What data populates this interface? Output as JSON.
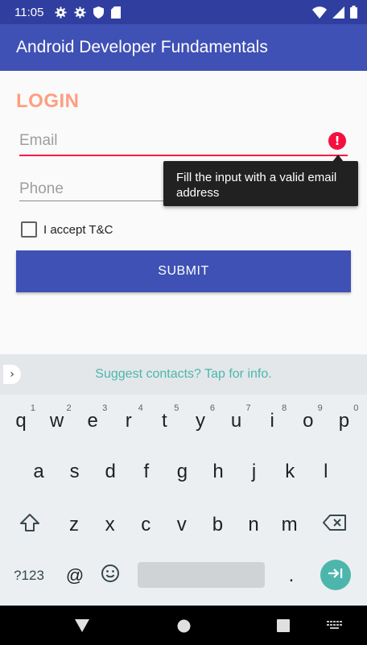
{
  "status_bar": {
    "time": "11:05",
    "left_icons": [
      "settings-icon",
      "settings-icon",
      "shield-icon",
      "sd-card-icon"
    ],
    "right_icons": [
      "wifi-icon",
      "signal-icon",
      "battery-icon"
    ]
  },
  "app_bar": {
    "title": "Android Developer Fundamentals"
  },
  "form": {
    "title": "LOGIN",
    "email_placeholder": "Email",
    "phone_placeholder": "Phone",
    "error_message": "Fill the input with a valid email address",
    "checkbox_label": "I accept T&C",
    "checkbox_checked": false,
    "submit_label": "SUBMIT"
  },
  "keyboard": {
    "suggestion": "Suggest contacts? Tap for info.",
    "row1": [
      {
        "k": "q",
        "h": "1"
      },
      {
        "k": "w",
        "h": "2"
      },
      {
        "k": "e",
        "h": "3"
      },
      {
        "k": "r",
        "h": "4"
      },
      {
        "k": "t",
        "h": "5"
      },
      {
        "k": "y",
        "h": "6"
      },
      {
        "k": "u",
        "h": "7"
      },
      {
        "k": "i",
        "h": "8"
      },
      {
        "k": "o",
        "h": "9"
      },
      {
        "k": "p",
        "h": "0"
      }
    ],
    "row2": [
      "a",
      "s",
      "d",
      "f",
      "g",
      "h",
      "j",
      "k",
      "l"
    ],
    "row3": [
      "z",
      "x",
      "c",
      "v",
      "b",
      "n",
      "m"
    ],
    "symbols_label": "?123",
    "at_label": "@",
    "period_label": ".",
    "emoji_icon": "emoji-icon",
    "shift_icon": "shift-icon",
    "backspace_icon": "backspace-icon",
    "enter_icon": "next-arrow-icon"
  },
  "nav_bar": {
    "icons": [
      "back-icon",
      "home-icon",
      "recents-icon",
      "keyboard-switch-icon"
    ]
  },
  "colors": {
    "primary": "#3f51b5",
    "primary_dark": "#303f9f",
    "login_title": "#ff9e80",
    "error": "#ff1744",
    "keyboard_accent": "#4db6ac"
  }
}
